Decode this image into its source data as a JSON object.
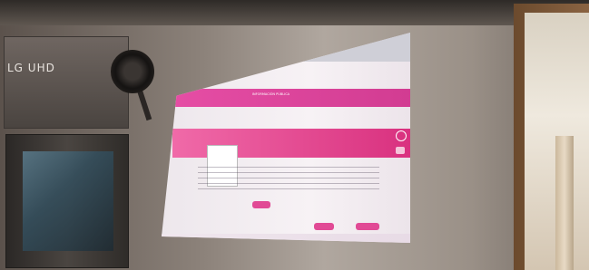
{
  "scene": {
    "tv_label": "LG UHD",
    "screen_title": "INFORMACIÓN PÚBLICA"
  },
  "colors": {
    "wall": "#9a9087",
    "banner": "#e64ea5",
    "screen_bg": "#f7f2f5"
  }
}
